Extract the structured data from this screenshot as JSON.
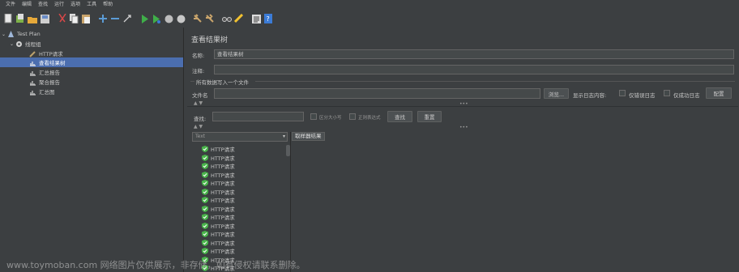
{
  "menu": [
    "文件",
    "编辑",
    "查找",
    "运行",
    "选项",
    "工具",
    "帮助"
  ],
  "toolbar_icons": [
    "new-icon",
    "templates-icon",
    "open-icon",
    "save-icon",
    "cut-icon",
    "copy-icon",
    "paste-icon",
    "expand-icon",
    "collapse-icon",
    "toggle-icon",
    "start-icon",
    "start-no-pause-icon",
    "stop-icon",
    "shutdown-icon",
    "clear-icon",
    "clear-all-icon",
    "search-icon",
    "reset-search-icon",
    "function-helper-icon",
    "help-icon"
  ],
  "tree": {
    "root": "Test Plan",
    "thread_group": "线程组",
    "items": [
      "HTTP请求",
      "查看结果树",
      "汇总报告",
      "聚合报告",
      "汇总图"
    ]
  },
  "main": {
    "title": "查看结果树",
    "name_label": "名称:",
    "name_value": "查看结果树",
    "comment_label": "注释:",
    "comment_value": "",
    "file_group_label": "所有数据写入一个文件",
    "filename_label": "文件名",
    "filename_value": "",
    "browse_button": "浏览...",
    "log_content_label": "显示日志内容:",
    "errors_only_label": "仅错误日志",
    "success_only_label": "仅成功日志",
    "configure_button": "配置",
    "search_label": "查找:",
    "case_sensitive_label": "区分大小写",
    "regex_label": "正则表达式",
    "find_button": "查找",
    "reset_button": "重置",
    "renderer_value": "Text",
    "sampler_result_tab": "取样器结果",
    "results": [
      "HTTP请求",
      "HTTP请求",
      "HTTP请求",
      "HTTP请求",
      "HTTP请求",
      "HTTP请求",
      "HTTP请求",
      "HTTP请求",
      "HTTP请求",
      "HTTP请求",
      "HTTP请求",
      "HTTP请求",
      "HTTP请求",
      "HTTP请求",
      "HTTP请求",
      "HTTP请求"
    ]
  },
  "watermark": "www.toymoban.com 网络图片仅供展示，非存储，如有侵权请联系删除。",
  "colors": {
    "background": "#3c3f41",
    "selection": "#4b6eaf",
    "success_green": "#49b34a"
  }
}
